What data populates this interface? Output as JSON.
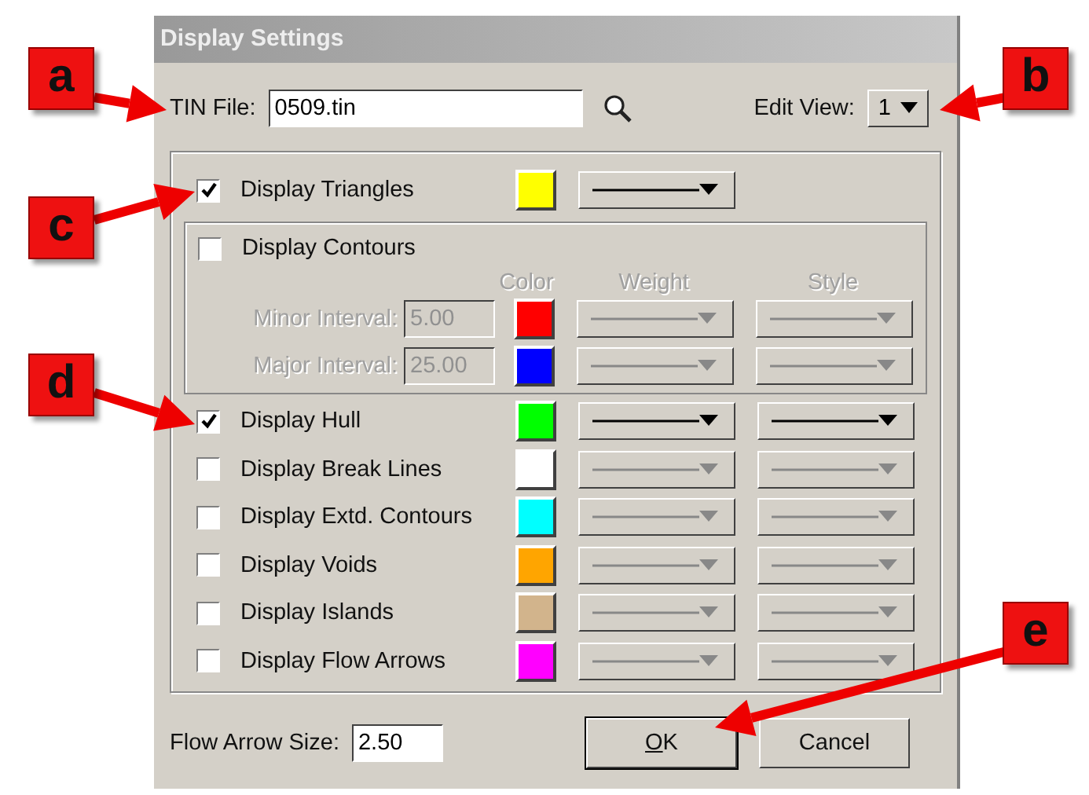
{
  "window": {
    "title": "Display Settings"
  },
  "tin_file": {
    "label": "TIN File:",
    "value": "0509.tin"
  },
  "edit_view": {
    "label": "Edit View:",
    "value": "1"
  },
  "triangles": {
    "label": "Display Triangles",
    "checked": true,
    "color": "#ffff00"
  },
  "contours": {
    "label": "Display Contours",
    "checked": false,
    "headers": [
      "Color",
      "Weight",
      "Style"
    ],
    "intervals": [
      {
        "label": "Minor Interval:",
        "value": "5.00",
        "color": "#ff0000"
      },
      {
        "label": "Major Interval:",
        "value": "25.00",
        "color": "#0000ff"
      }
    ]
  },
  "layers": [
    {
      "label": "Display Hull",
      "checked": true,
      "color": "#00ff00"
    },
    {
      "label": "Display Break Lines",
      "checked": false,
      "color": "#ffffff"
    },
    {
      "label": "Display Extd. Contours",
      "checked": false,
      "color": "#00ffff"
    },
    {
      "label": "Display Voids",
      "checked": false,
      "color": "#ffa500"
    },
    {
      "label": "Display Islands",
      "checked": false,
      "color": "#d2b48c"
    },
    {
      "label": "Display Flow Arrows",
      "checked": false,
      "color": "#ff00ff"
    }
  ],
  "flow_arrow_size": {
    "label": "Flow Arrow Size:",
    "value": "2.50"
  },
  "buttons": [
    {
      "label": "OK",
      "default": true,
      "mnemonic": true
    },
    {
      "label": "Cancel",
      "default": false,
      "mnemonic": false
    }
  ],
  "callouts": [
    {
      "letter": "a"
    },
    {
      "letter": "b"
    },
    {
      "letter": "c"
    },
    {
      "letter": "d"
    },
    {
      "letter": "e"
    }
  ]
}
